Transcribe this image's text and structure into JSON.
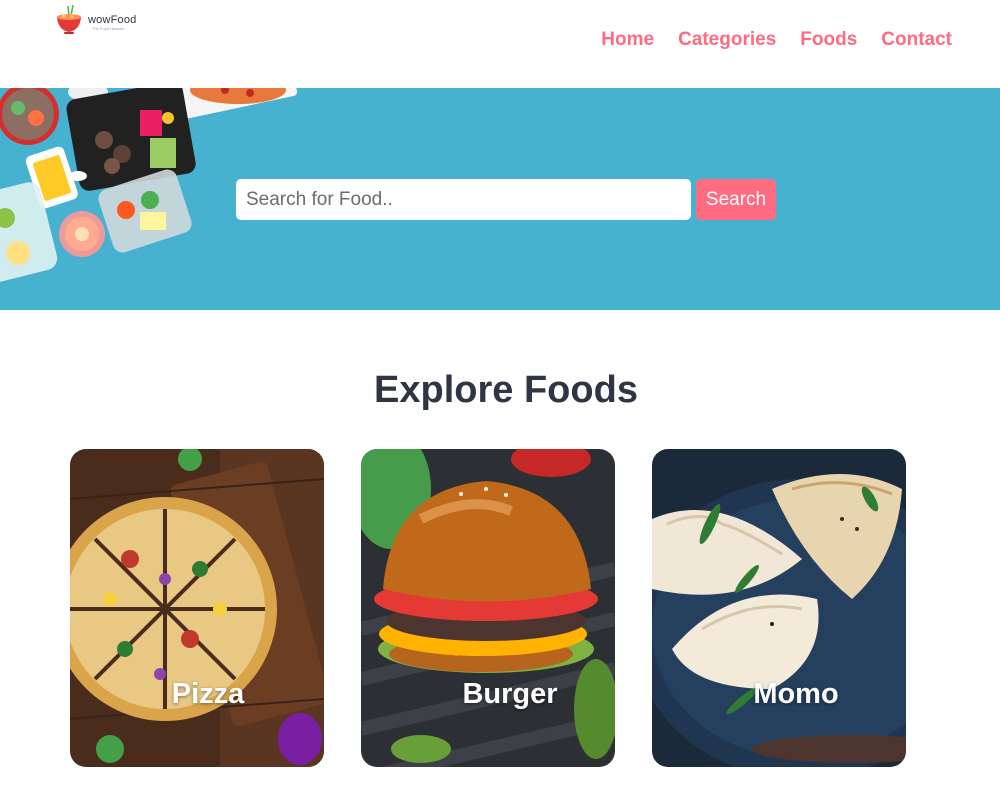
{
  "brand": {
    "name": "wowFood",
    "tagline": "The Food Heaven"
  },
  "nav": {
    "items": [
      {
        "label": "Home"
      },
      {
        "label": "Categories"
      },
      {
        "label": "Foods"
      },
      {
        "label": "Contact"
      }
    ]
  },
  "search": {
    "placeholder": "Search for Food..",
    "value": "",
    "button_label": "Search"
  },
  "explore": {
    "title": "Explore Foods",
    "categories": [
      {
        "label": "Pizza",
        "image": "pizza-image"
      },
      {
        "label": "Burger",
        "image": "burger-image"
      },
      {
        "label": "Momo",
        "image": "momo-image"
      }
    ]
  },
  "colors": {
    "accent": "#ff6b81",
    "hero_bg": "#47b2d0",
    "heading": "#2f3542"
  }
}
